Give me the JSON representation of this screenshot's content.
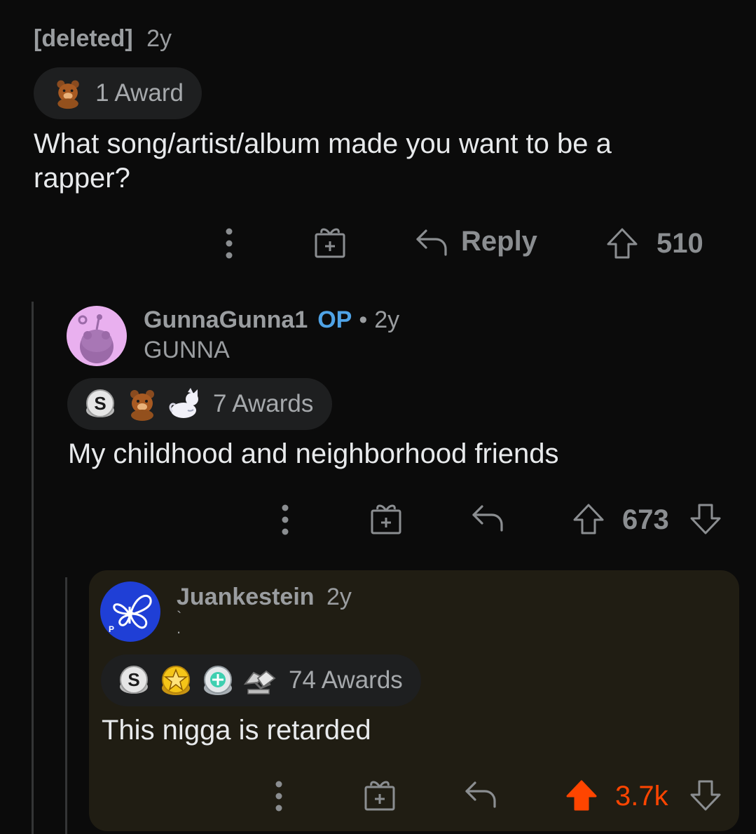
{
  "comments": [
    {
      "user": "[deleted]",
      "age": "2y",
      "awards_label": "1 Award",
      "award_icons": [
        "bear-award-icon"
      ],
      "body_line1": "What song/artist/album made you want to be a",
      "body_line2": "rapper?",
      "reply_label": "Reply",
      "vote_count": "510"
    },
    {
      "user": "GunnaGunna1",
      "op_badge": "OP",
      "separator": "•",
      "age": "2y",
      "flair": "GUNNA",
      "awards_label": "7 Awards",
      "award_icons": [
        "silver-award-icon",
        "bear-award-icon",
        "cat-award-icon"
      ],
      "body": "My childhood and neighborhood friends",
      "vote_count": "673"
    },
    {
      "user": "Juankestein",
      "age": "2y",
      "flair": "` .",
      "awards_label": "74 Awards",
      "award_icons": [
        "silver-award-icon",
        "gold-star-award-icon",
        "platinum-award-icon",
        "handshake-award-icon"
      ],
      "body": "This nigga is retarded",
      "vote_count": "3.7k",
      "vote_state": "upvoted"
    }
  ],
  "colors": {
    "background": "#0b0b0b",
    "upvote": "#ff4500",
    "op": "#4fa3e6",
    "highlight": "#201d13"
  }
}
